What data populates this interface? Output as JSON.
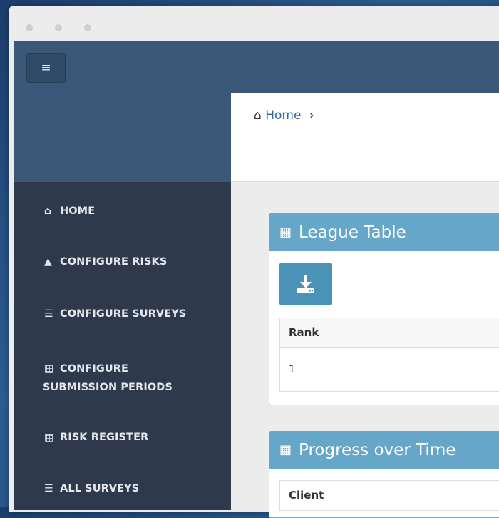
{
  "nav": {
    "menu_icon": "hamburger-icon",
    "menu_glyph": "≡"
  },
  "breadcrumb": {
    "home_icon": "home-icon",
    "home": "Home",
    "separator": "›"
  },
  "sidebar": {
    "items": [
      {
        "icon": "home-icon",
        "glyph": "⌂",
        "label": "HOME"
      },
      {
        "icon": "warning-icon",
        "glyph": "▲",
        "label": "CONFIGURE RISKS"
      },
      {
        "icon": "list-icon",
        "glyph": "☰",
        "label": "CONFIGURE SURVEYS"
      },
      {
        "icon": "calendar-icon",
        "glyph": "▦",
        "label_line1": "CONFIGURE",
        "label_line2": "SUBMISSION PERIODS"
      },
      {
        "icon": "table-icon",
        "glyph": "▦",
        "label": "RISK REGISTER"
      },
      {
        "icon": "list-icon",
        "glyph": "☰",
        "label": "ALL SURVEYS"
      }
    ]
  },
  "league_table": {
    "title": "League Table",
    "icon": "table-icon",
    "download_icon": "download-icon",
    "columns": [
      "Rank"
    ],
    "rows": [
      [
        "1"
      ]
    ]
  },
  "progress_over_time": {
    "title": "Progress over Time",
    "icon": "table-icon",
    "columns": [
      "Client"
    ]
  },
  "colors": {
    "topbar": "#3b5878",
    "sidebar": "#2e3a4c",
    "panel_header": "#66a7c9",
    "download_button": "#4a93b7",
    "link": "#2e6da4"
  }
}
